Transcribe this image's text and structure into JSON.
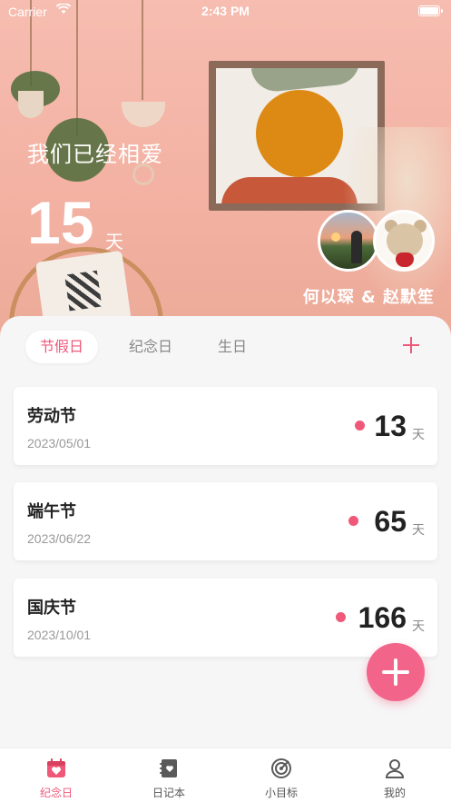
{
  "status_bar": {
    "carrier": "Carrier",
    "time": "2:43 PM"
  },
  "hero": {
    "title": "我们已经相爱",
    "days": "15",
    "unit": "天",
    "names": "何以琛 & 赵默笙"
  },
  "tabs": [
    {
      "label": "节假日",
      "active": true
    },
    {
      "label": "纪念日",
      "active": false
    },
    {
      "label": "生日",
      "active": false
    }
  ],
  "events": [
    {
      "name": "劳动节",
      "date": "2023/05/01",
      "days": "13",
      "unit": "天"
    },
    {
      "name": "端午节",
      "date": "2023/06/22",
      "days": "65",
      "unit": "天"
    },
    {
      "name": "国庆节",
      "date": "2023/10/01",
      "days": "166",
      "unit": "天"
    }
  ],
  "tabbar": [
    {
      "label": "纪念日",
      "icon": "calendar-heart-icon",
      "active": true
    },
    {
      "label": "日记本",
      "icon": "notebook-icon",
      "active": false
    },
    {
      "label": "小目标",
      "icon": "target-icon",
      "active": false
    },
    {
      "label": "我的",
      "icon": "user-icon",
      "active": false
    }
  ],
  "colors": {
    "accent": "#f0587a",
    "fab": "#f2648a",
    "hero_bg": "#f3b2a3"
  }
}
